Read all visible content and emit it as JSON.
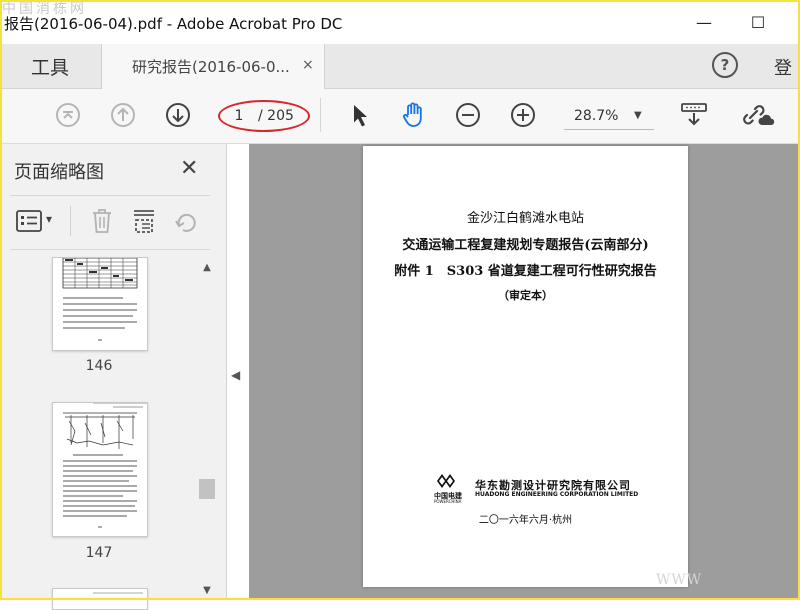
{
  "window": {
    "title": "报告(2016-06-04).pdf - Adobe Acrobat Pro DC",
    "watermark_top": "中国消栋网",
    "minimize_symbol": "—",
    "maximize_symbol": "☐"
  },
  "tabs": {
    "tools_label": "工具",
    "doc_label": "研究报告(2016-06-0...",
    "close_symbol": "×",
    "help_symbol": "?",
    "login_label": "登"
  },
  "toolbar": {
    "current_page": "1",
    "total_pages": "/ 205",
    "zoom": "28.7%",
    "zoom_dropdown": "▼"
  },
  "thumbnails_panel": {
    "title": "页面缩略图",
    "close_symbol": "✕",
    "dropdown_symbol": "▾",
    "items": [
      {
        "label": "146"
      },
      {
        "label": "147"
      }
    ],
    "collapse_symbol": "◀",
    "scroll_up": "▲",
    "scroll_down": "▼"
  },
  "document": {
    "line1": "金沙江白鹤滩水电站",
    "line2": "交通运输工程复建规划专题报告(云南部分)",
    "line3": "附件 1　S303 省道复建工程可行性研究报告",
    "line4": "（审定本）",
    "logo_cn": "中国电建",
    "logo_en": "POWERCHINA",
    "company_cn": "华东勘测设计研究院有限公司",
    "company_en": "HUADONG ENGINEERING CORPORATION LIMITED",
    "date": "二〇一六年六月·杭州"
  },
  "watermark_bottom": "WWW",
  "colors": {
    "accent_red": "#d8242b",
    "frame_yellow": "#f5e23a",
    "hand_blue": "#1473e6"
  }
}
